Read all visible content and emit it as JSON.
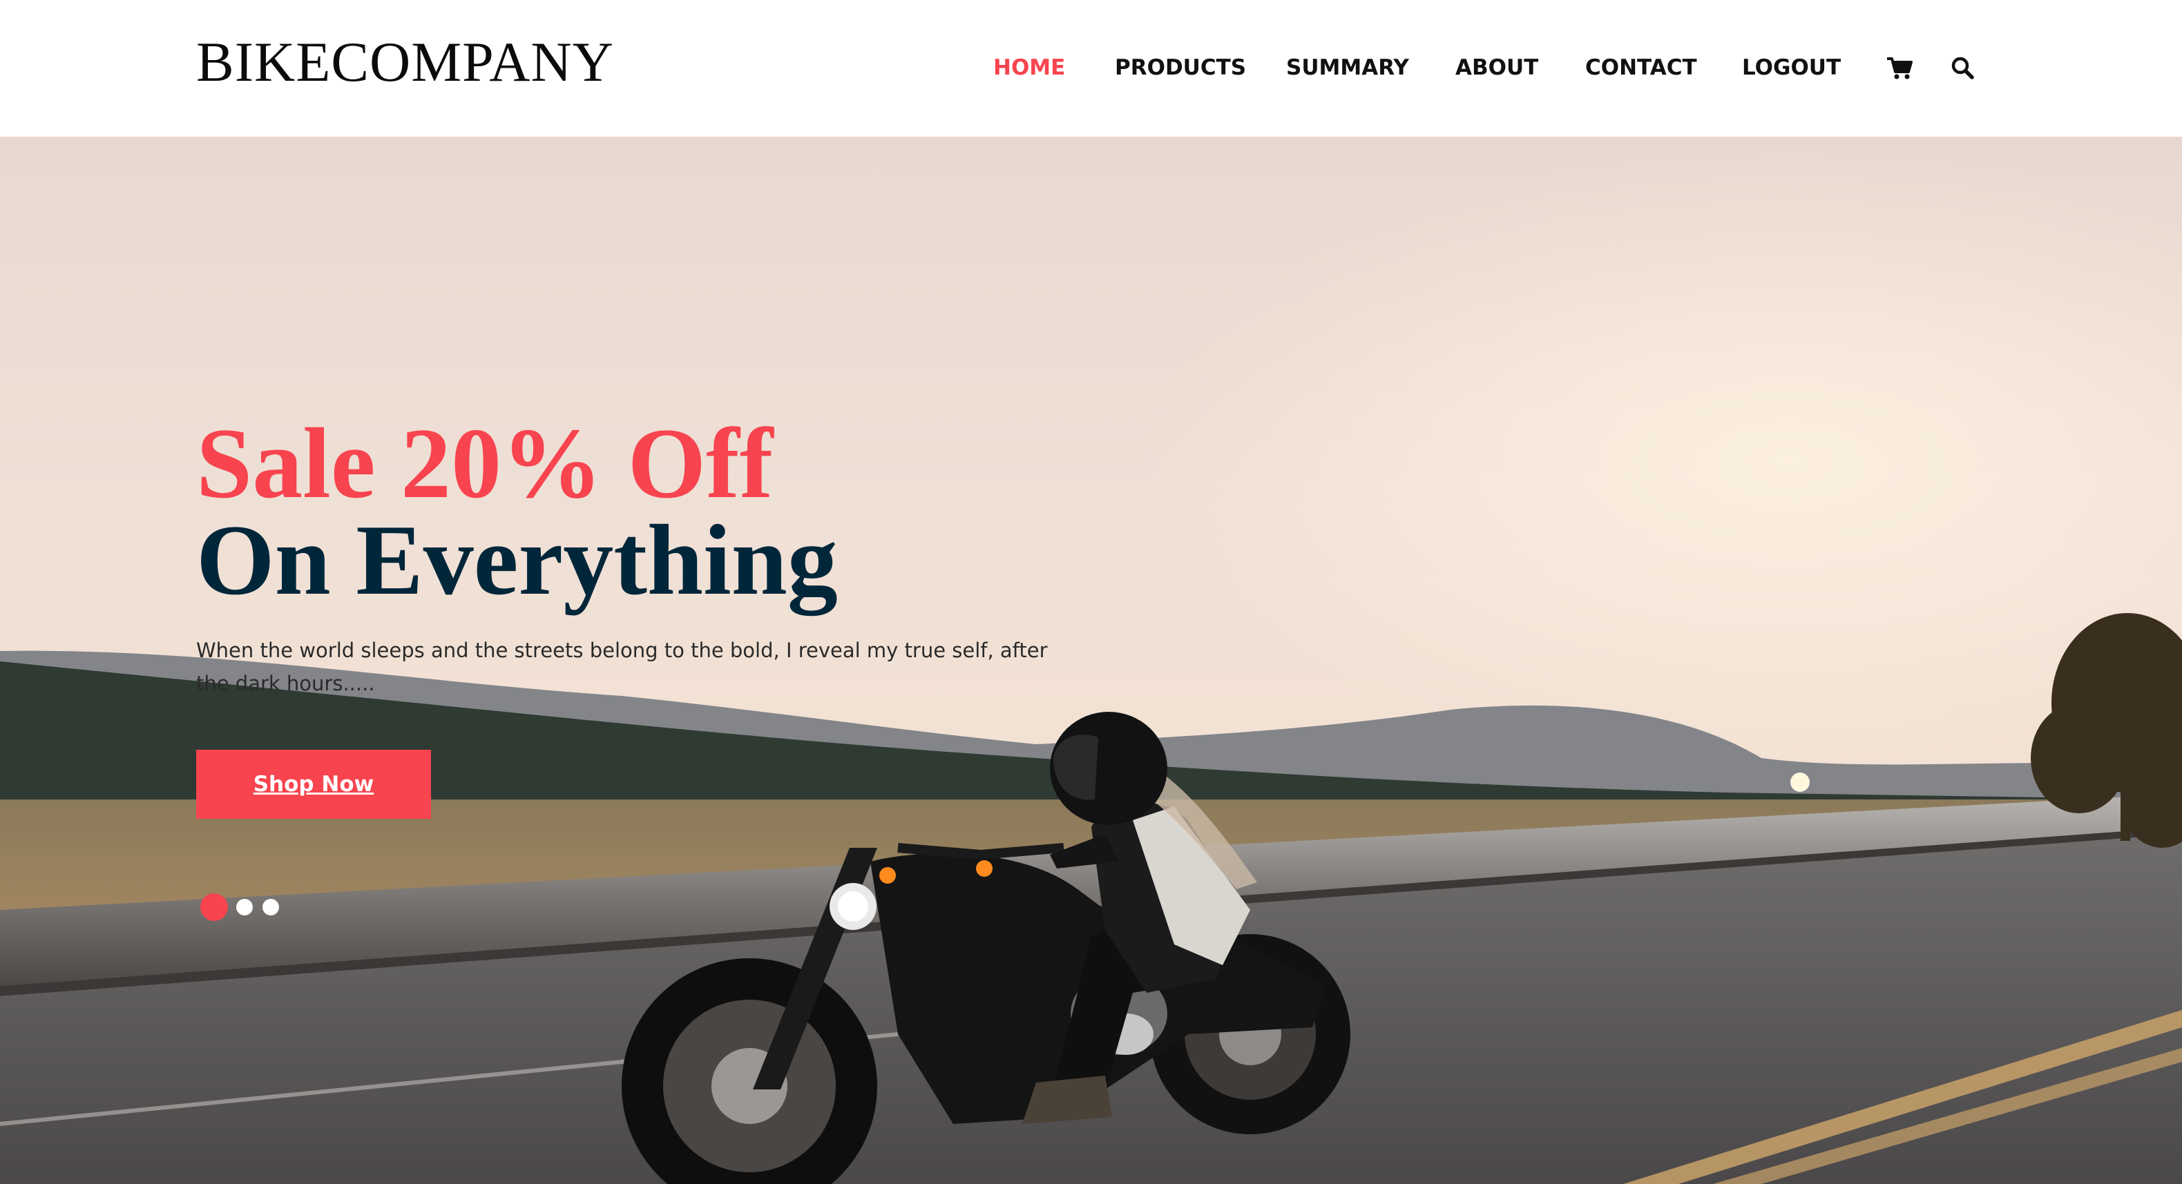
{
  "brand": {
    "name": "BIKECOMPANY"
  },
  "nav": {
    "items": [
      {
        "label": "HOME",
        "active": true
      },
      {
        "label": "PRODUCTS",
        "active": false
      },
      {
        "label": "SUMMARY",
        "active": false
      },
      {
        "label": "ABOUT",
        "active": false
      },
      {
        "label": "CONTACT",
        "active": false
      },
      {
        "label": "LOGOUT",
        "active": false
      }
    ],
    "icons": [
      "cart-icon",
      "search-icon"
    ]
  },
  "hero": {
    "headline_line1": "Sale 20% Off",
    "headline_line2": "On Everything",
    "description": "When the world sleeps and the streets belong to the bold, I reveal my true self, after the dark hours.....",
    "cta_label": "Shop Now",
    "slides_total": 3,
    "active_slide": 1
  },
  "colors": {
    "accent": "#f7444e",
    "headline_dark": "#00263a",
    "nav_text": "#111111",
    "header_bg": "#ffffff"
  }
}
